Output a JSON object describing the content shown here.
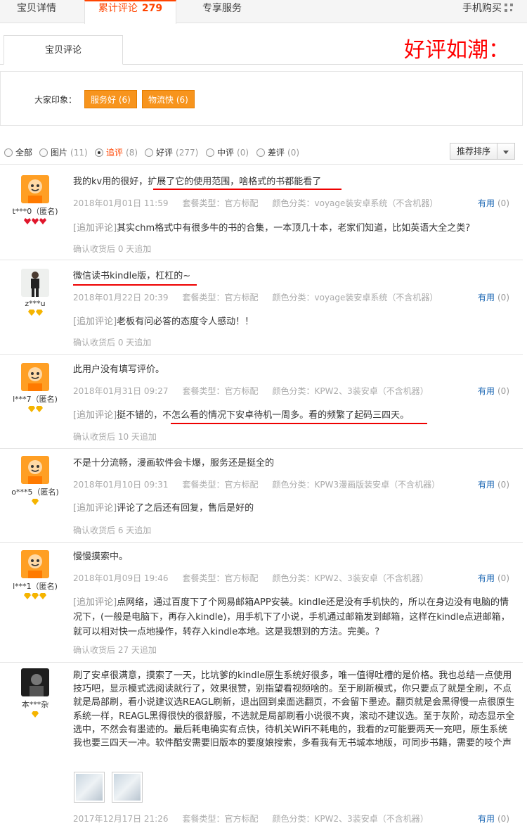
{
  "top_tabs": {
    "detail": "宝贝详情",
    "reviews": "累计评论",
    "reviews_count": "279",
    "service": "专享服务",
    "mobile": "手机购买"
  },
  "sub_tab": "宝贝评论",
  "slogan": "好评如潮：",
  "impressions": {
    "label": "大家印象：",
    "tags": [
      "服务好 (6)",
      "物流快 (6)"
    ]
  },
  "filter": {
    "options": [
      {
        "label": "全部",
        "count": ""
      },
      {
        "label": "图片",
        "count": "(11)"
      },
      {
        "label": "追评",
        "count": "(8)"
      },
      {
        "label": "好评",
        "count": "(277)"
      },
      {
        "label": "中评",
        "count": "(0)"
      },
      {
        "label": "差评",
        "count": "(0)"
      }
    ],
    "sort": "推荐排序"
  },
  "reviews": [
    {
      "user": "t***0（匿名)",
      "content": "我的kv用的很好，扩展了它的使用范围，啥格式的书都能看了",
      "date": "2018年01月01日 11:59",
      "package": "套餐类型：官方标配",
      "color": "颜色分类：voyage装安卓系统（不含机器）",
      "useful_label": "有用",
      "useful_count": "(0)",
      "append_tag": "[追加评论]",
      "append": "其实chm格式中有很多牛的书的合集，一本顶几十本，老家们知道，比如英语大全之类?",
      "confirm": "确认收货后 0 天追加"
    },
    {
      "user": "z***u",
      "content": "微信读书kindle版，杠杠的~",
      "date": "2018年01月22日 20:39",
      "package": "套餐类型：官方标配",
      "color": "颜色分类：voyage装安卓系统（不含机器）",
      "useful_label": "有用",
      "useful_count": "(0)",
      "append_tag": "[追加评论]",
      "append": "老板有问必答的态度令人感动！！",
      "confirm": "确认收货后 0 天追加"
    },
    {
      "user": "l***7（匿名)",
      "content": "此用户没有填写评价。",
      "date": "2018年01月31日 09:27",
      "package": "套餐类型：官方标配",
      "color": "颜色分类：KPW2、3装安卓（不含机器）",
      "useful_label": "有用",
      "useful_count": "(0)",
      "append_tag": "[追加评论]",
      "append": "挺不错的，不怎么看的情况下安卓待机一周多。看的频繁了起码三四天。",
      "confirm": "确认收货后 10 天追加"
    },
    {
      "user": "o***5（匿名)",
      "content": "不是十分流畅，漫画软件会卡爆，服务还是挺全的",
      "date": "2018年01月10日 09:31",
      "package": "套餐类型：官方标配",
      "color": "颜色分类：KPW3漫画版装安卓（不含机器）",
      "useful_label": "有用",
      "useful_count": "(0)",
      "append_tag": "[追加评论]",
      "append": "评论了之后还有回复，售后是好的",
      "confirm": "确认收货后 6 天追加"
    },
    {
      "user": "l***1（匿名)",
      "content": "慢慢摸索中。",
      "date": "2018年01月09日 19:46",
      "package": "套餐类型：官方标配",
      "color": "颜色分类：KPW2、3装安卓（不含机器）",
      "useful_label": "有用",
      "useful_count": "(0)",
      "append_tag": "[追加评论]",
      "append": "点网络，通过百度下了个网易邮箱APP安装。kindle还是没有手机快的，所以在身边没有电脑的情况下，(一般是电脑下，再存入kindle)，用手机下了小说，手机通过邮箱发到邮箱，这样在kindle点进邮箱，就可以相对快一点地操作，转存入kindle本地。这是我想到的方法。完美。?",
      "confirm": "确认收货后 27 天追加"
    },
    {
      "user": "本***杂",
      "content": "刷了安卓很满意，摸索了一天，比坑爹的kindle原生系统好很多，唯一值得吐槽的是价格。我也总结一点使用技巧吧，显示模式选阅读就行了，效果很赞，别指望看视频啥的。至于刷新模式，你只要点了就是全刷，不点就是局部刷，看小说建议选REAGL刷新，退出回到桌面选翻页，不会留下墨迹。翻页就是会黑得慢一点很原生系统一样，REAGL黑得很快的很舒服，不选就是局部刷看小说很不爽，滚动不建议选。至于灰阶，动态显示全选中，不然会有墨迹的。最后耗电确实有点快，待机关WiFi不耗电的，我看的z可能要两天一充吧，原生系统我也要三四天一冲。软件酷安需要旧版本的要度娘搜索，多看我有无书城本地版，可同步书籍，需要的吱个声",
      "date": "2017年12月17日 21:26",
      "package": "套餐类型：官方标配",
      "color": "颜色分类：KPW2、3装安卓（不含机器）",
      "useful_label": "有用",
      "useful_count": "(0)"
    }
  ],
  "colors": {
    "accent": "#ff4400",
    "tag_bg": "#f7941d",
    "slogan": "#ff0000",
    "link": "#1a66b3"
  }
}
